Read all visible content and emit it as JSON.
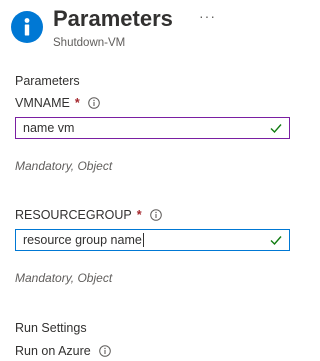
{
  "header": {
    "title": "Parameters",
    "more": "···",
    "subtitle": "Shutdown-VM"
  },
  "parameters": {
    "section_title": "Parameters",
    "fields": [
      {
        "label": "VMNAME",
        "required": "*",
        "value": "name vm",
        "hint": "Mandatory, Object"
      },
      {
        "label": "RESOURCEGROUP",
        "required": "*",
        "value": "resource group name",
        "hint": "Mandatory, Object"
      }
    ]
  },
  "run_settings": {
    "section_title": "Run Settings",
    "run_on_label": "Run on Azure"
  },
  "colors": {
    "accent": "#0078d4",
    "valid_check": "#107c10",
    "required": "#a4262c",
    "input_border": "#7a1fa2"
  },
  "icons": {
    "header": "info-circle-icon",
    "field_info": "info-icon",
    "valid": "checkmark-icon",
    "more": "more-horizontal-icon"
  }
}
